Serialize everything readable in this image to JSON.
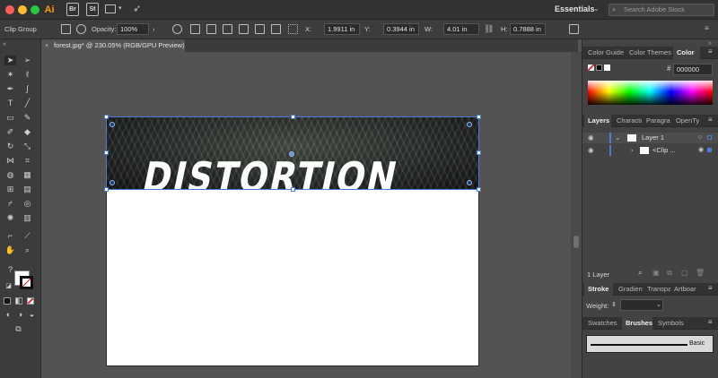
{
  "app": {
    "name": "Ai",
    "bridge": "Br",
    "stock": "St",
    "workspace": "Essentials",
    "search_placeholder": "Search Adobe Stock"
  },
  "control_bar": {
    "selection_label": "Clip Group",
    "opacity_label": "Opacity:",
    "opacity_value": "100%",
    "x_label": "X:",
    "x_value": "1.9911 in",
    "y_label": "Y:",
    "y_value": "0.3944 in",
    "w_label": "W:",
    "w_value": "4.01 in",
    "h_label": "H:",
    "h_value": "0.7888 in"
  },
  "document": {
    "tab_title": "forest.jpg* @ 230.05% (RGB/GPU Preview)",
    "art_text": "DISTORTION"
  },
  "color_panel": {
    "tabs": [
      "Color Guide",
      "Color Themes",
      "Color"
    ],
    "hex_symbol": "#",
    "hex_value": "000000"
  },
  "layers_panel": {
    "tabs": [
      "Layers",
      "Characte",
      "Paragra",
      "OpenTy"
    ],
    "layers": [
      {
        "name": "Layer 1"
      },
      {
        "name": "<Clip ..."
      }
    ],
    "footer": "1 Layer"
  },
  "stroke_panel": {
    "tabs": [
      "Stroke",
      "Gradien",
      "Transpa",
      "Artboar"
    ],
    "weight_label": "Weight:"
  },
  "brushes_panel": {
    "tabs": [
      "Swatches",
      "Brushes",
      "Symbols"
    ],
    "brush_name": "Basic"
  },
  "colors": {
    "selection": "#4a7bd8",
    "panel_bg": "#434343",
    "canvas_bg": "#535353"
  }
}
